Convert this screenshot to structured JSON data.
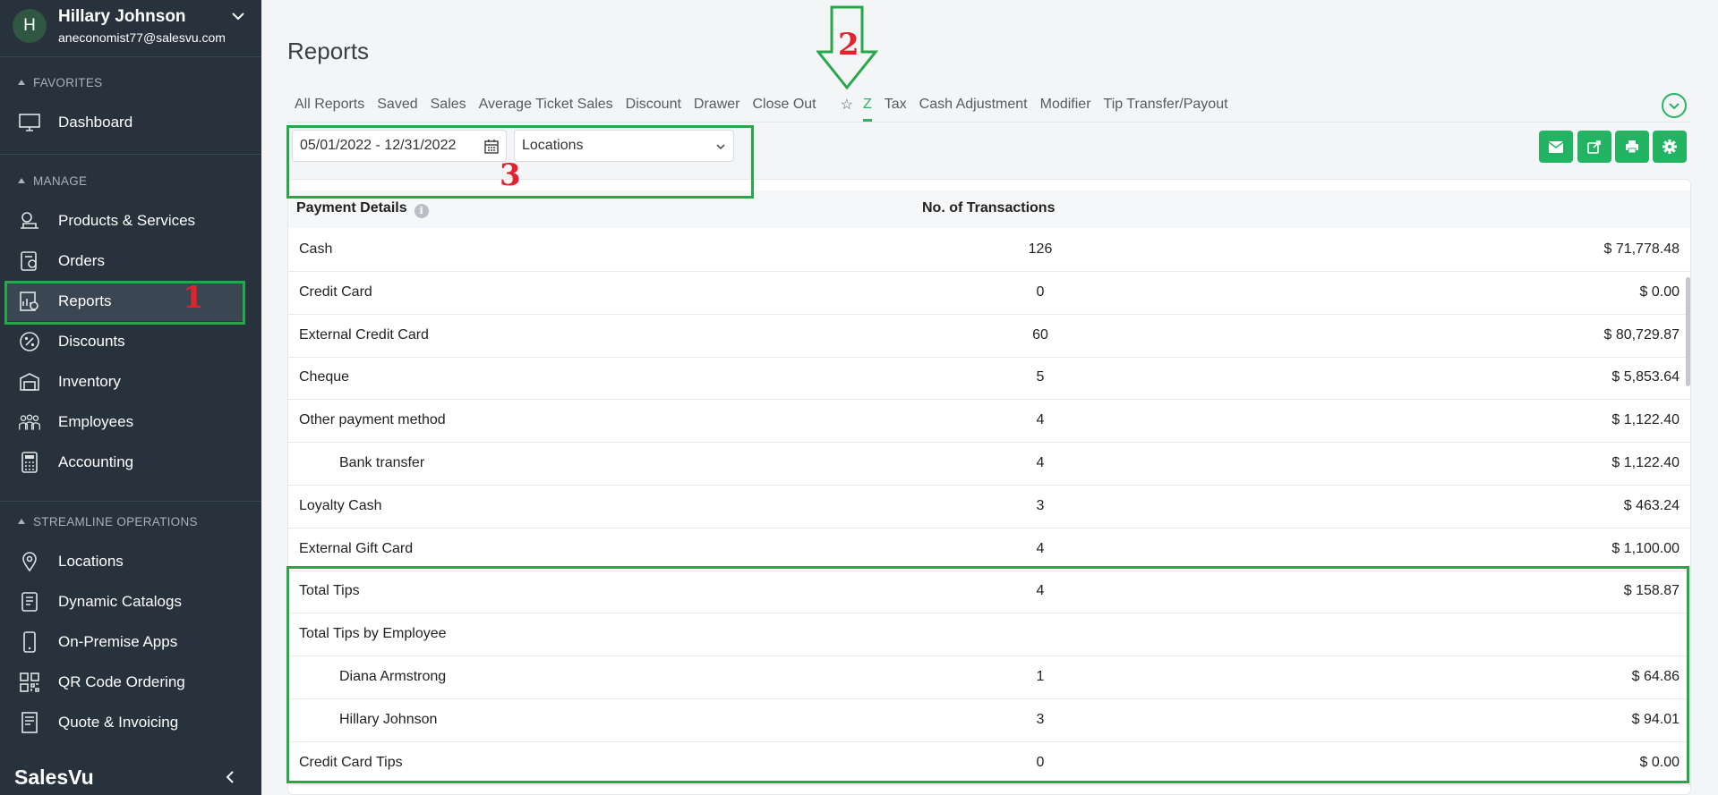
{
  "user": {
    "initial": "H",
    "name": "Hillary Johnson",
    "email": "aneconomist77@salesvu.com"
  },
  "sidebar": {
    "sections": {
      "favorites": "FAVORITES",
      "manage": "MANAGE",
      "streamline": "STREAMLINE OPERATIONS"
    },
    "favorites": [
      {
        "label": "Dashboard",
        "icon": "monitor-icon"
      }
    ],
    "manage": [
      {
        "label": "Products & Services",
        "icon": "products-icon"
      },
      {
        "label": "Orders",
        "icon": "orders-icon"
      },
      {
        "label": "Reports",
        "icon": "reports-icon"
      },
      {
        "label": "Discounts",
        "icon": "percent-icon"
      },
      {
        "label": "Inventory",
        "icon": "inventory-icon"
      },
      {
        "label": "Employees",
        "icon": "employees-icon"
      },
      {
        "label": "Accounting",
        "icon": "calculator-icon"
      }
    ],
    "streamline": [
      {
        "label": "Locations",
        "icon": "location-pin-icon"
      },
      {
        "label": "Dynamic Catalogs",
        "icon": "catalog-icon"
      },
      {
        "label": "On-Premise Apps",
        "icon": "phone-icon"
      },
      {
        "label": "QR Code Ordering",
        "icon": "qr-code-icon"
      },
      {
        "label": "Quote & Invoicing",
        "icon": "invoice-icon"
      }
    ],
    "brand": "SalesVu"
  },
  "page": {
    "title": "Reports"
  },
  "tabs": [
    "All Reports",
    "Saved",
    "Sales",
    "Average Ticket Sales",
    "Discount",
    "Drawer",
    "Close Out",
    "Z",
    "Tax",
    "Cash Adjustment",
    "Modifier",
    "Tip Transfer/Payout"
  ],
  "active_tab": "Z",
  "filters": {
    "date_range": "05/01/2022 - 12/31/2022",
    "location": "Locations"
  },
  "table": {
    "headers": {
      "details": "Payment Details",
      "transactions": "No. of Transactions"
    },
    "rows": [
      {
        "name": "Cash",
        "count": "126",
        "amount": "$ 71,778.48"
      },
      {
        "name": "Credit Card",
        "count": "0",
        "amount": "$ 0.00"
      },
      {
        "name": "External Credit Card",
        "count": "60",
        "amount": "$ 80,729.87"
      },
      {
        "name": "Cheque",
        "count": "5",
        "amount": "$ 5,853.64"
      },
      {
        "name": "Other payment method",
        "count": "4",
        "amount": "$ 1,122.40"
      },
      {
        "name": "Bank transfer",
        "count": "4",
        "amount": "$ 1,122.40"
      },
      {
        "name": "Loyalty Cash",
        "count": "3",
        "amount": "$ 463.24"
      },
      {
        "name": "External Gift Card",
        "count": "4",
        "amount": "$ 1,100.00"
      },
      {
        "name": "Total Tips",
        "count": "4",
        "amount": "$ 158.87"
      },
      {
        "name": "Total Tips by Employee",
        "count": "",
        "amount": ""
      },
      {
        "name": "Diana Armstrong",
        "count": "1",
        "amount": "$ 64.86"
      },
      {
        "name": "Hillary Johnson",
        "count": "3",
        "amount": "$ 94.01"
      },
      {
        "name": "Credit Card Tips",
        "count": "0",
        "amount": "$ 0.00"
      }
    ]
  },
  "annotations": {
    "one": "1",
    "two": "2",
    "three": "3"
  },
  "colors": {
    "sidebar_bg": "#27323d",
    "accent": "#22b463",
    "annotation_box": "#26a84a",
    "annotation_number": "#e0232d"
  }
}
